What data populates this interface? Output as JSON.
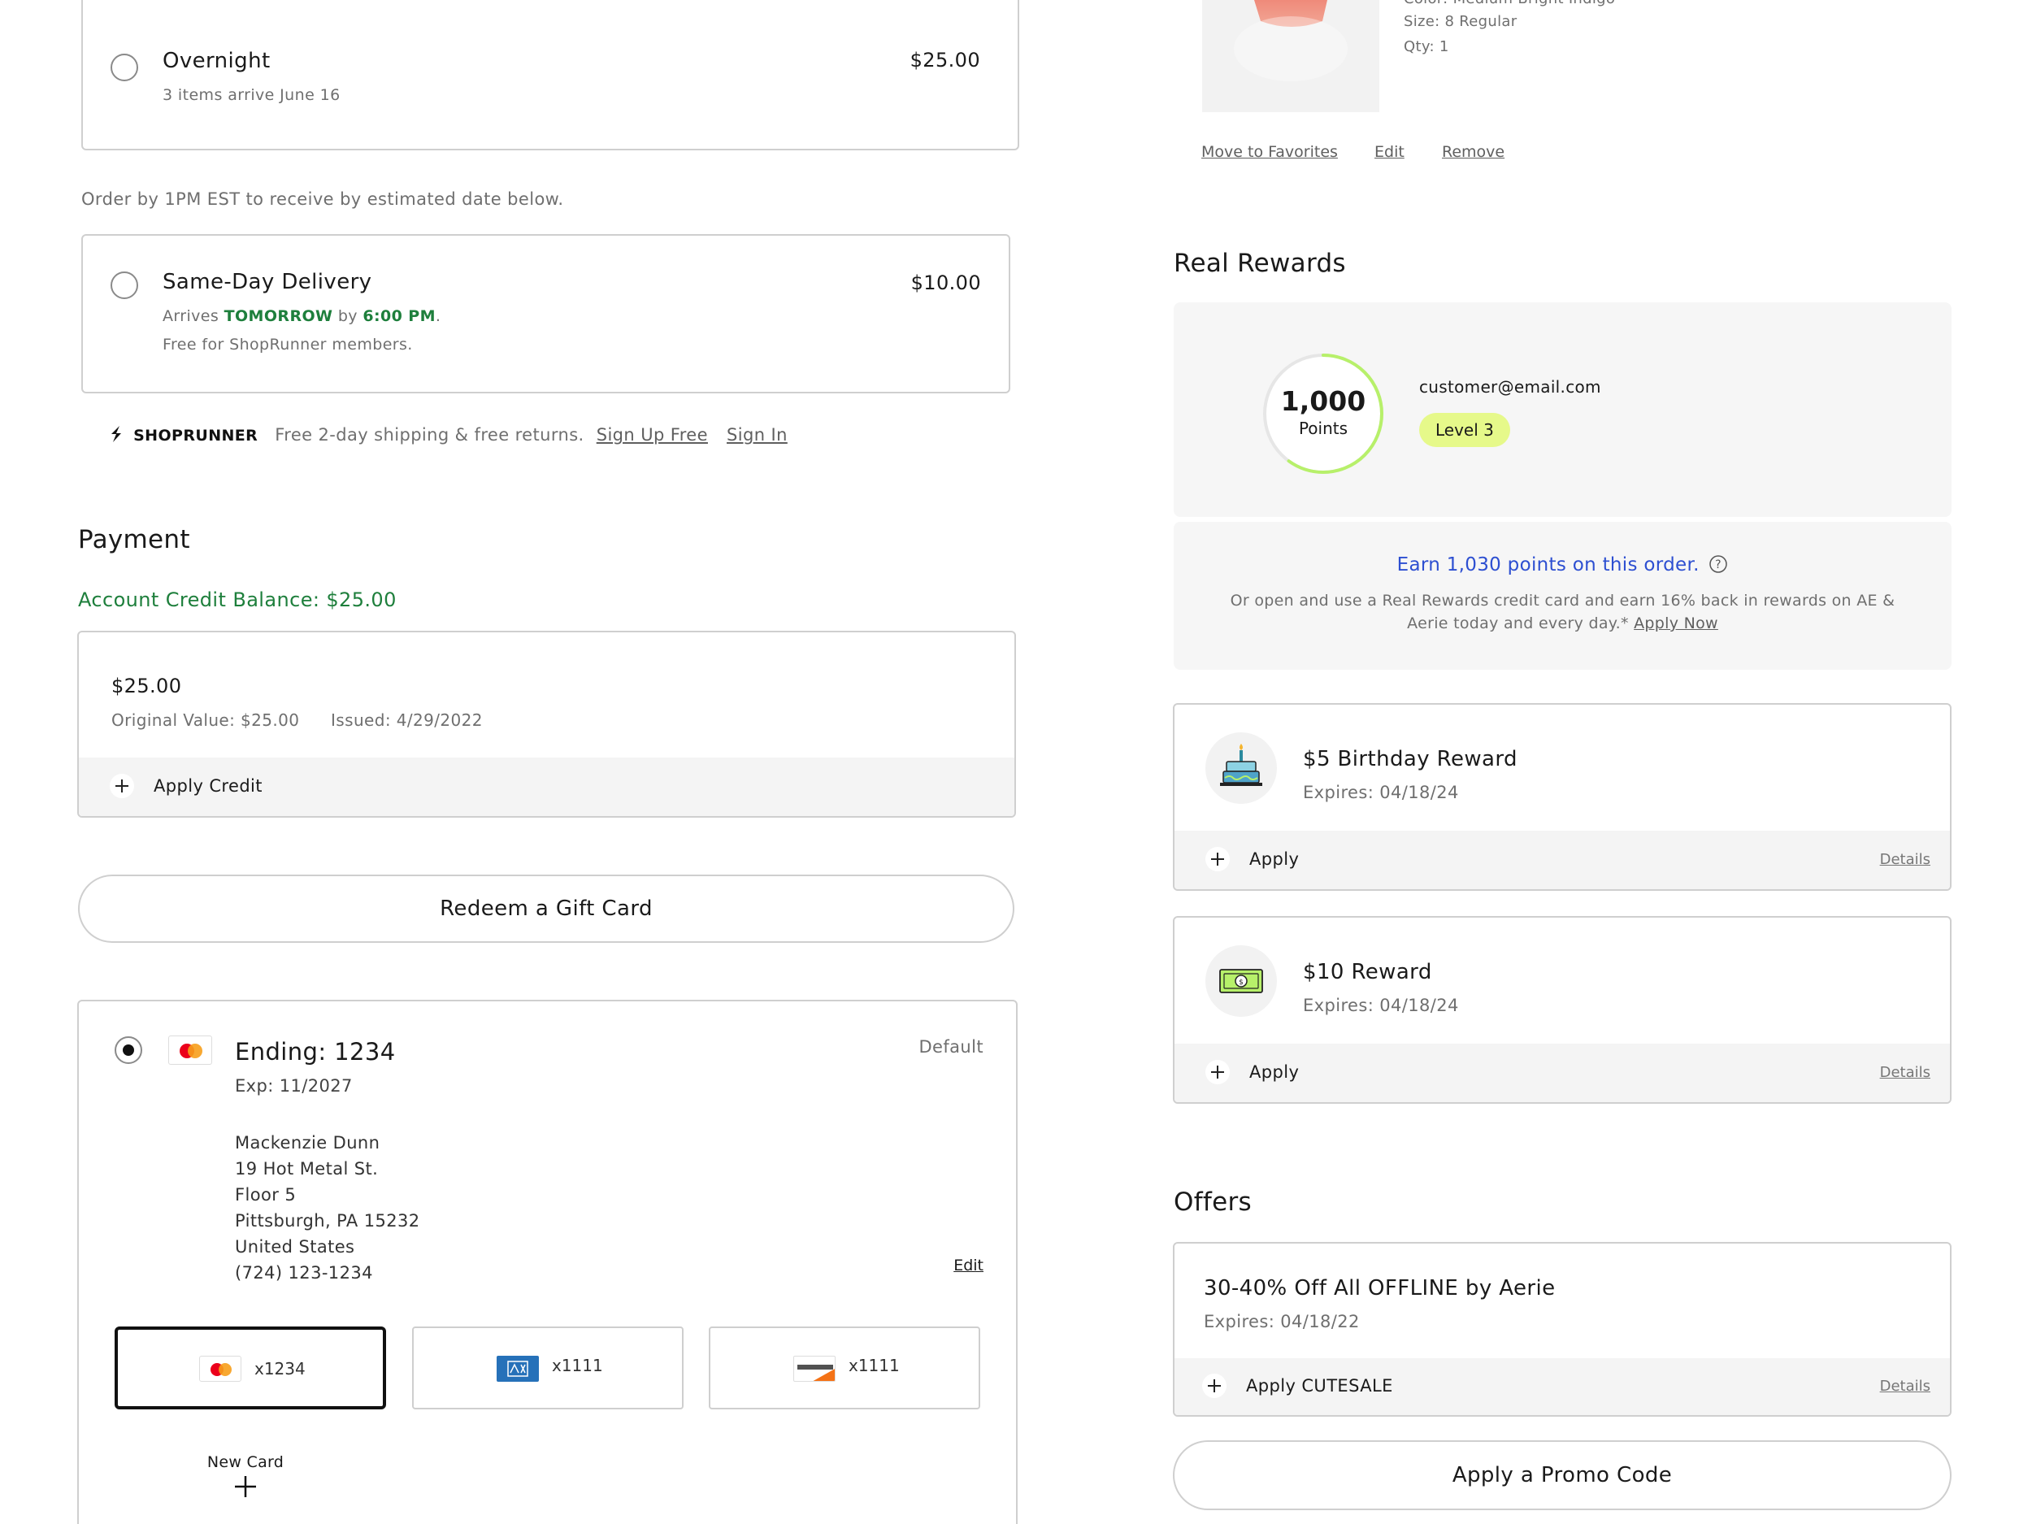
{
  "shipping": {
    "overnight": {
      "title": "Overnight",
      "sub": "3 items arrive June 16",
      "price": "$25.00"
    },
    "order_by_note": "Order by 1PM EST to receive by estimated date below.",
    "same_day": {
      "title": "Same-Day Delivery",
      "price": "$10.00",
      "arrives_prefix": "Arrives ",
      "arrives_day": "TOMORROW",
      "arrives_mid": " by ",
      "arrives_time": "6:00 PM",
      "arrives_suffix": ".",
      "note": "Free for ShopRunner members."
    },
    "shoprunner": {
      "brand": "SHOPRUNNER",
      "text": "Free 2-day shipping & free returns.",
      "signup": "Sign Up Free",
      "signin": "Sign In"
    }
  },
  "payment": {
    "heading": "Payment",
    "credit_balance": "Account Credit Balance: $25.00",
    "credit": {
      "amount": "$25.00",
      "original": "Original Value: $25.00",
      "issued": "Issued: 4/29/2022",
      "apply": "Apply Credit"
    },
    "gift_card_button": "Redeem a Gift Card",
    "saved_card": {
      "title": "Ending: 1234",
      "exp": "Exp: 11/2027",
      "default_label": "Default",
      "address": [
        "Mackenzie Dunn",
        "19 Hot Metal St.",
        "Floor 5",
        "Pittsburgh, PA 15232",
        "United States",
        "(724) 123-1234"
      ],
      "edit": "Edit"
    },
    "card_tiles": [
      {
        "brand": "mastercard",
        "label": "x1234"
      },
      {
        "brand": "amex",
        "label": "x1111"
      },
      {
        "brand": "discover",
        "label": "x1111"
      }
    ],
    "new_card": "New Card"
  },
  "cart_item": {
    "color": "Color: Medium Bright Indigo",
    "size": "Size: 8 Regular",
    "qty": "Qty: 1",
    "actions": {
      "favorites": "Move to Favorites",
      "edit": "Edit",
      "remove": "Remove"
    }
  },
  "rewards": {
    "heading": "Real Rewards",
    "points": "1,000",
    "points_label": "Points",
    "points_progress": 0.6,
    "email": "customer@email.com",
    "level": "Level 3",
    "earn": "Earn 1,030 points on this order.",
    "card_offer_line1": "Or open and use a Real Rewards credit card and earn 16% back in rewards on AE &",
    "card_offer_line2": "Aerie today and every day.*",
    "apply_now": "Apply Now",
    "items": [
      {
        "title": "$5 Birthday Reward",
        "expires": "Expires: 04/18/24",
        "apply": "Apply",
        "details": "Details",
        "icon": "birthday-cake-icon"
      },
      {
        "title": "$10 Reward",
        "expires": "Expires: 04/18/24",
        "apply": "Apply",
        "details": "Details",
        "icon": "cash-icon"
      }
    ]
  },
  "offers": {
    "heading": "Offers",
    "item": {
      "title": "30-40% Off All OFFLINE by Aerie",
      "expires": "Expires: 04/18/22",
      "apply": "Apply CUTESALE",
      "details": "Details"
    },
    "promo_button": "Apply a Promo Code"
  },
  "colors": {
    "green": "#1e7f3c",
    "blue_link": "#2d4fd1",
    "level_badge": "#e6f98a",
    "ring": "#b7f06a"
  }
}
